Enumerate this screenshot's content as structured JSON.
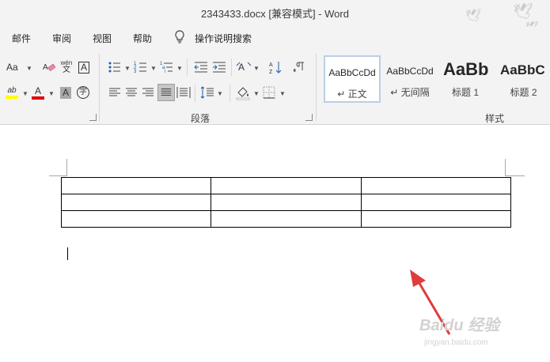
{
  "window": {
    "title": "2343433.docx [兼容模式]  -  Word"
  },
  "menu": {
    "items": [
      "邮件",
      "审阅",
      "视图",
      "帮助"
    ],
    "search_label": "操作说明搜索"
  },
  "ribbon": {
    "font_group": {
      "change_case_label": "Aa",
      "phonetic_top": "wén",
      "phonetic_bottom": "文",
      "char_border_label": "A",
      "font_color_label": "A",
      "char_shading_label": "A",
      "enclose_label": "字",
      "highlight_label": "ab"
    },
    "paragraph_label": "段落",
    "styles_label": "样式",
    "styles": [
      {
        "sample": "AaBbCcDd",
        "name": "↵ 正文",
        "selected": true
      },
      {
        "sample": "AaBbCcDd",
        "name": "↵ 无间隔",
        "selected": false
      },
      {
        "sample": "AaBb",
        "name": "标题 1",
        "selected": false
      },
      {
        "sample": "AaBbC",
        "name": "标题 2",
        "selected": false
      }
    ]
  },
  "document": {
    "table": {
      "rows": 3,
      "cols": 3
    }
  },
  "watermark": {
    "brand": "Baidu 经验",
    "url": "jingyan.baidu.com"
  },
  "colors": {
    "ribbon_bg": "#f3f3f3",
    "selected_style_border": "#b9cfe7",
    "arrow": "#e03c3c",
    "font_color_bar": "#e00000",
    "highlight_bar": "#ffff00"
  }
}
